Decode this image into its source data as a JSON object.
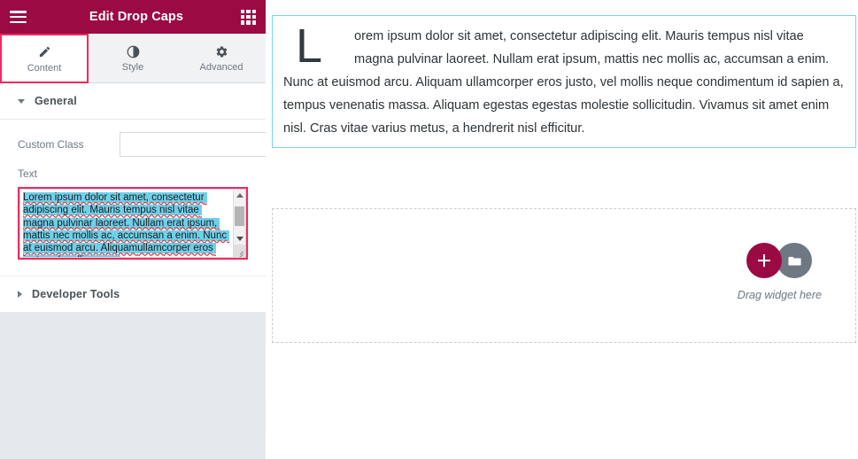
{
  "panel": {
    "header": {
      "title": "Edit Drop Caps",
      "menu_icon": "hamburger-icon",
      "apps_icon": "apps-grid-icon"
    },
    "tabs": [
      {
        "label": "Content",
        "icon": "pencil-icon",
        "active": true
      },
      {
        "label": "Style",
        "icon": "contrast-icon",
        "active": false
      },
      {
        "label": "Advanced",
        "icon": "gear-icon",
        "active": false
      }
    ],
    "sections": [
      {
        "title": "General",
        "expanded": true
      },
      {
        "title": "Developer Tools",
        "expanded": false
      }
    ],
    "controls": {
      "custom_class": {
        "label": "Custom Class",
        "value": "",
        "placeholder": "",
        "dynamic_icon": "database-stack-icon"
      },
      "text": {
        "label": "Text",
        "selected_text": "Lorem ipsum dolor sit amet, consectetur adipiscing elit. Mauris tempus nisl vitae magna pulvinar laoreet. Nullam erat ipsum, mattis nec mollis ac, accumsan a enim. Nunc at euismod arcu. Aliquam",
        "clipped_line": "ullamcorper eros iusto vel mollis neque",
        "scrollbar": {
          "up_icon": "scroll-up-arrow-icon",
          "down_icon": "scroll-down-arrow-icon",
          "resize_icon": "resize-grip-icon"
        }
      }
    },
    "collapse_toggle": {
      "icon": "chevron-left-icon",
      "label": "‹"
    }
  },
  "preview": {
    "text_widget": {
      "dropcap": "L",
      "body": "orem ipsum dolor sit amet, consectetur adipiscing elit. Mauris tempus nisl vitae magna pulvinar laoreet. Nullam erat ipsum, mattis nec mollis ac, accumsan a enim. Nunc at euismod arcu. Aliquam ullamcorper eros justo, vel mollis neque condimentum id sapien a, tempus venenatis massa. Aliquam egestas egestas molestie sollicitudin. Vivamus sit amet enim nisl. Cras vitae varius metus, a hendrerit nisl efficitur."
    },
    "dropzone": {
      "caption": "Drag widget here",
      "add_icon": "plus-icon",
      "folder_icon": "folder-icon"
    }
  },
  "colors": {
    "brand": "#9b0a43",
    "accent_highlight": "#f2295b",
    "selection_blue": "#6fd0ea",
    "widget_outline": "#7ed3ef",
    "panel_bg": "#e6e9ec",
    "muted_text": "#6d7882"
  }
}
